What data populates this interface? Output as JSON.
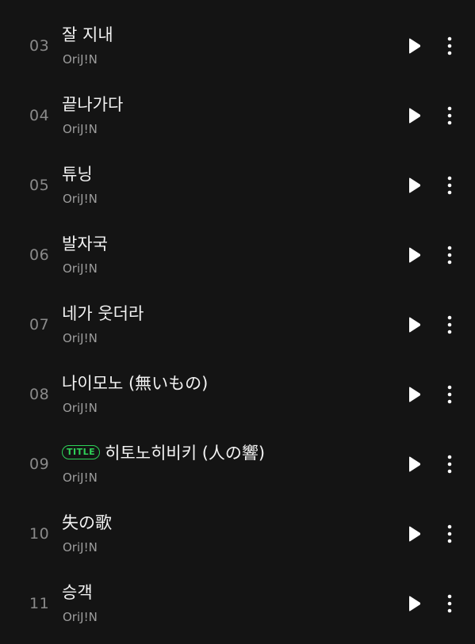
{
  "tracks": [
    {
      "number": "03",
      "title": "잘 지내",
      "artist": "OriJ!N",
      "badge": ""
    },
    {
      "number": "04",
      "title": "끝나가다",
      "artist": "OriJ!N",
      "badge": ""
    },
    {
      "number": "05",
      "title": "튜닝",
      "artist": "OriJ!N",
      "badge": ""
    },
    {
      "number": "06",
      "title": "발자국",
      "artist": "OriJ!N",
      "badge": ""
    },
    {
      "number": "07",
      "title": "네가 웃더라",
      "artist": "OriJ!N",
      "badge": ""
    },
    {
      "number": "08",
      "title": "나이모노 (無いもの)",
      "artist": "OriJ!N",
      "badge": ""
    },
    {
      "number": "09",
      "title": "히토노히비키 (人の響)",
      "artist": "OriJ!N",
      "badge": "TITLE"
    },
    {
      "number": "10",
      "title": "失の歌",
      "artist": "OriJ!N",
      "badge": ""
    },
    {
      "number": "11",
      "title": "승객",
      "artist": "OriJ!N",
      "badge": ""
    }
  ],
  "icons": {
    "play": "play-icon",
    "more": "more-vertical-icon"
  },
  "colors": {
    "background": "#141414",
    "title": "#f2f2f2",
    "artist": "#9d9d9d",
    "number": "#8a8a8a",
    "badge": "#2ed158",
    "icon": "#ffffff"
  }
}
